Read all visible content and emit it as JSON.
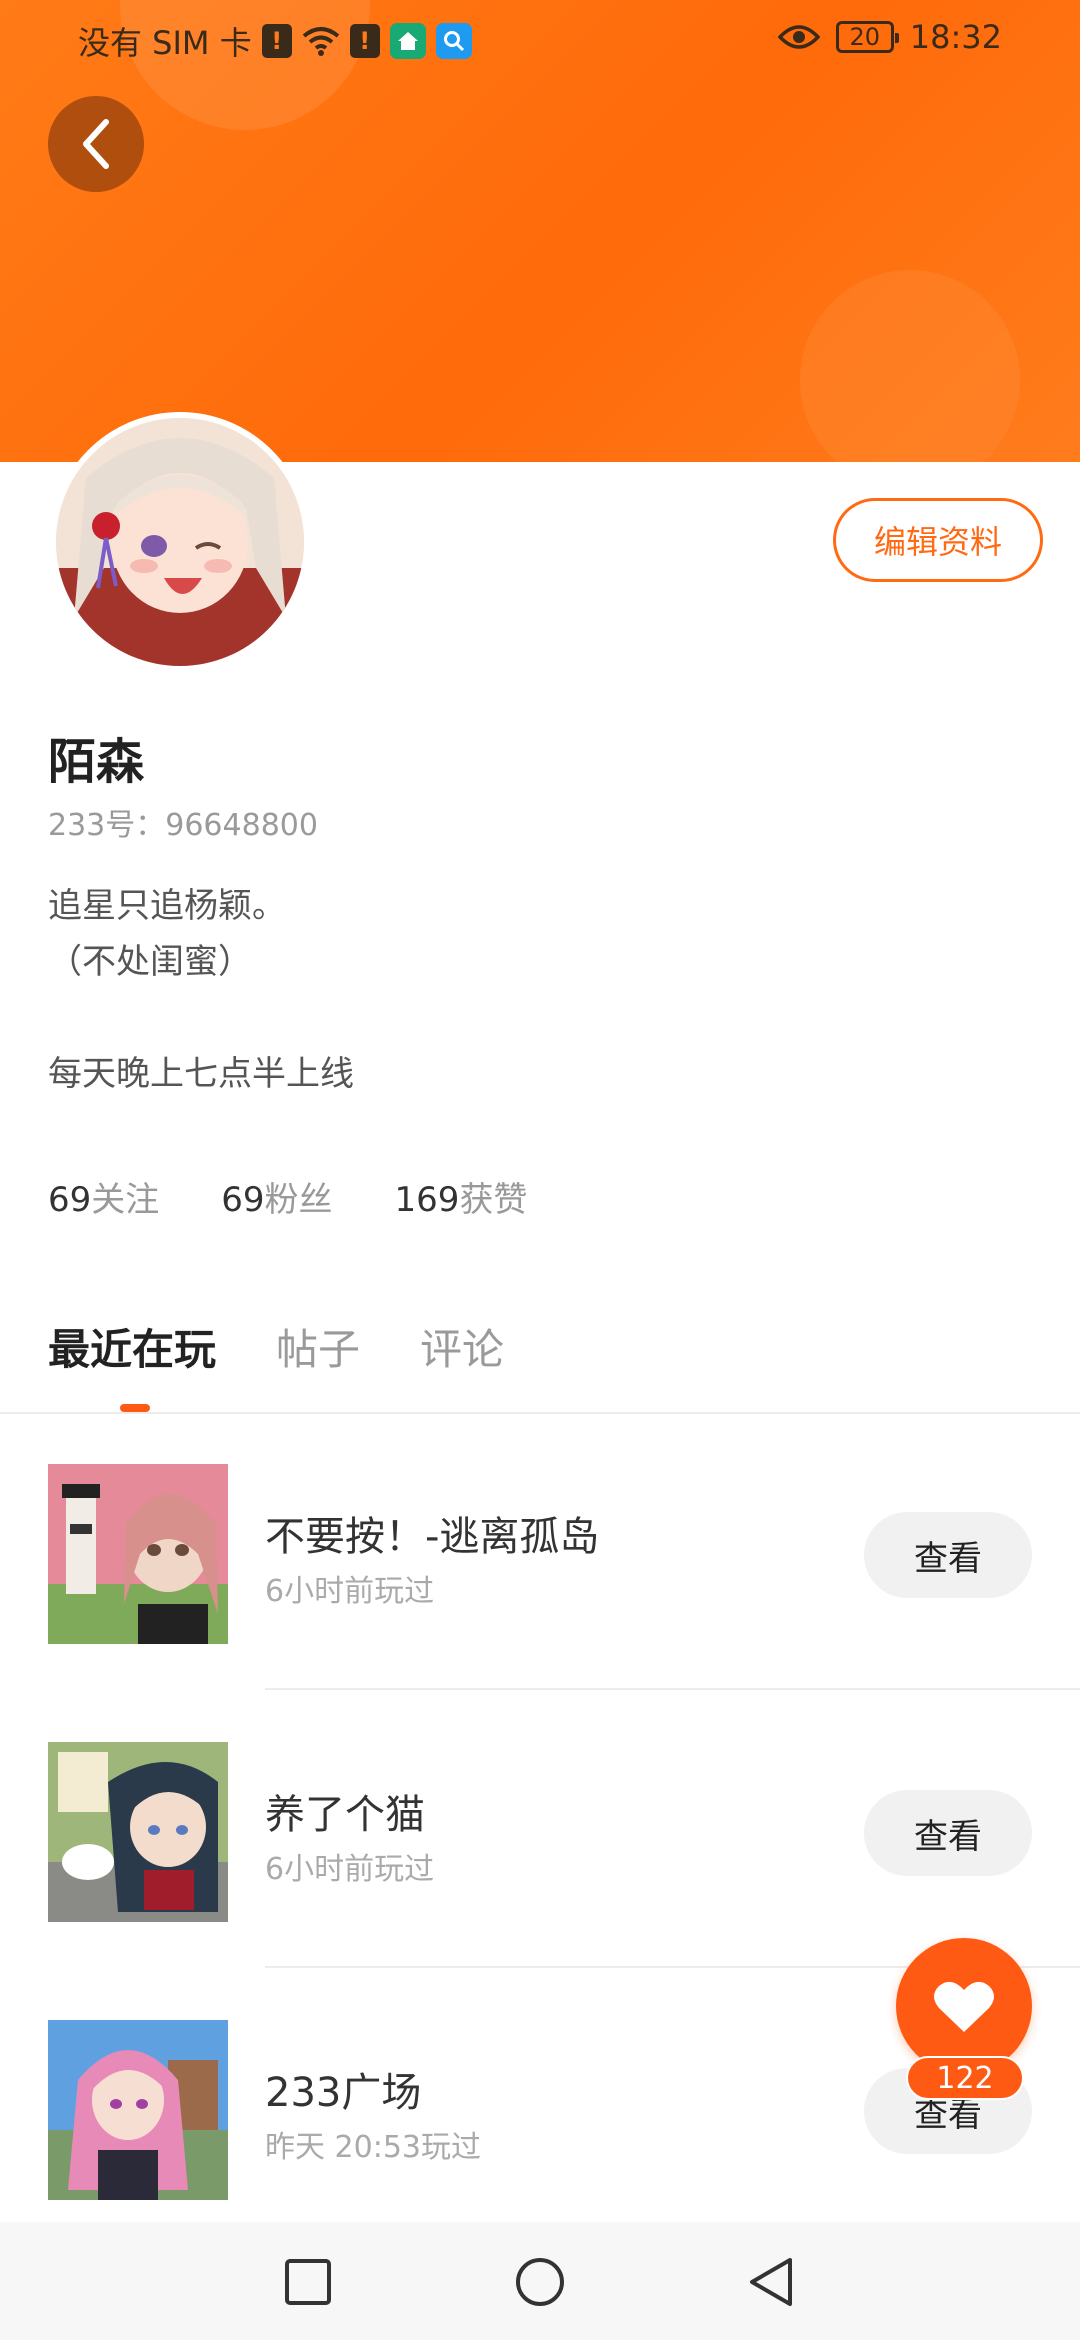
{
  "status_bar": {
    "carrier": "没有 SIM 卡",
    "alert_badge": "!",
    "battery": "20",
    "time": "18:32"
  },
  "profile": {
    "edit_label": "编辑资料",
    "name": "陌森",
    "id_text": "233号：96648800",
    "bio_lines": [
      "追星只追杨颖。",
      "（不处闺蜜）",
      "",
      "每天晚上七点半上线"
    ]
  },
  "stats": [
    {
      "num": "69",
      "label": "关注"
    },
    {
      "num": "69",
      "label": "粉丝"
    },
    {
      "num": "169",
      "label": "获赞"
    }
  ],
  "tabs": [
    {
      "label": "最近在玩",
      "active": true
    },
    {
      "label": "帖子",
      "active": false
    },
    {
      "label": "评论",
      "active": false
    }
  ],
  "games": [
    {
      "title": "不要按！-逃离孤岛",
      "time": "6小时前玩过",
      "button": "查看"
    },
    {
      "title": "养了个猫",
      "time": "6小时前玩过",
      "button": "查看"
    },
    {
      "title": "233广场",
      "time": "昨天 20:53玩过",
      "button": "查看"
    }
  ],
  "like": {
    "count": "122"
  },
  "colors": {
    "accent": "#ff5a14",
    "banner": "#ff7b17"
  },
  "icons": [
    "back-icon",
    "heart-icon",
    "wifi-icon",
    "eye-icon",
    "nav-recents-icon",
    "nav-home-icon",
    "nav-back-icon"
  ]
}
